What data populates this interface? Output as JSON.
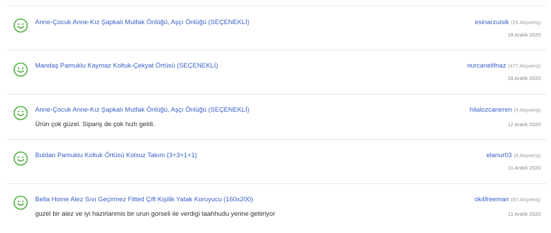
{
  "colors": {
    "link": "#3a5fc8",
    "smile": "#4caf3a",
    "text": "#333333",
    "muted": "#999999"
  },
  "reviews": [
    {
      "product": "Anne-Çocuk Anne-Kız Şapkalı Mutfak Önlüğü, Aşçı Önlüğü (SEÇENEKLİ)",
      "comment": "",
      "user": "esinarzuisik",
      "purchases": "(29 Alışveriş)",
      "date": "18 Aralık 2020",
      "icon": "smile-icon"
    },
    {
      "product": "Mandaş Pamuklu Kaymaz Koltuk-Çekyat Örtüsü (SEÇENEKLİ)",
      "comment": "",
      "user": "nurcanelifnaz",
      "purchases": "(477 Alışveriş)",
      "date": "16 Aralık 2020",
      "icon": "smile-icon"
    },
    {
      "product": "Anne-Çocuk Anne-Kız Şapkalı Mutfak Önlüğü, Aşçı Önlüğü (SEÇENEKLİ)",
      "comment": "Ürün çok güzel. Sipariş de çok hızlı geldi.",
      "user": "hilalozcaneren",
      "purchases": "(4 Alışveriş)",
      "date": "12 Aralık 2020",
      "icon": "smile-icon"
    },
    {
      "product": "Buldan Pamuklu Koltuk Örtüsü Kolsuz Takım (3+3+1+1)",
      "comment": "",
      "user": "elanur03",
      "purchases": "(9 Alışveriş)",
      "date": "11 Aralık 2020",
      "icon": "smile-icon"
    },
    {
      "product": "Bella Home Alez Sıvı Geçirmez Fitted Çift Kişilik Yatak Koruyucu (160x200)",
      "comment": "guzel bir alez ve iyi hazirlanmis bir urun gorseli ile verdigi taahhudu yerine getiiriyor",
      "user": "ok4freeman",
      "purchases": "(87 Alışveriş)",
      "date": "11 Aralık 2020",
      "icon": "smile-icon"
    }
  ]
}
